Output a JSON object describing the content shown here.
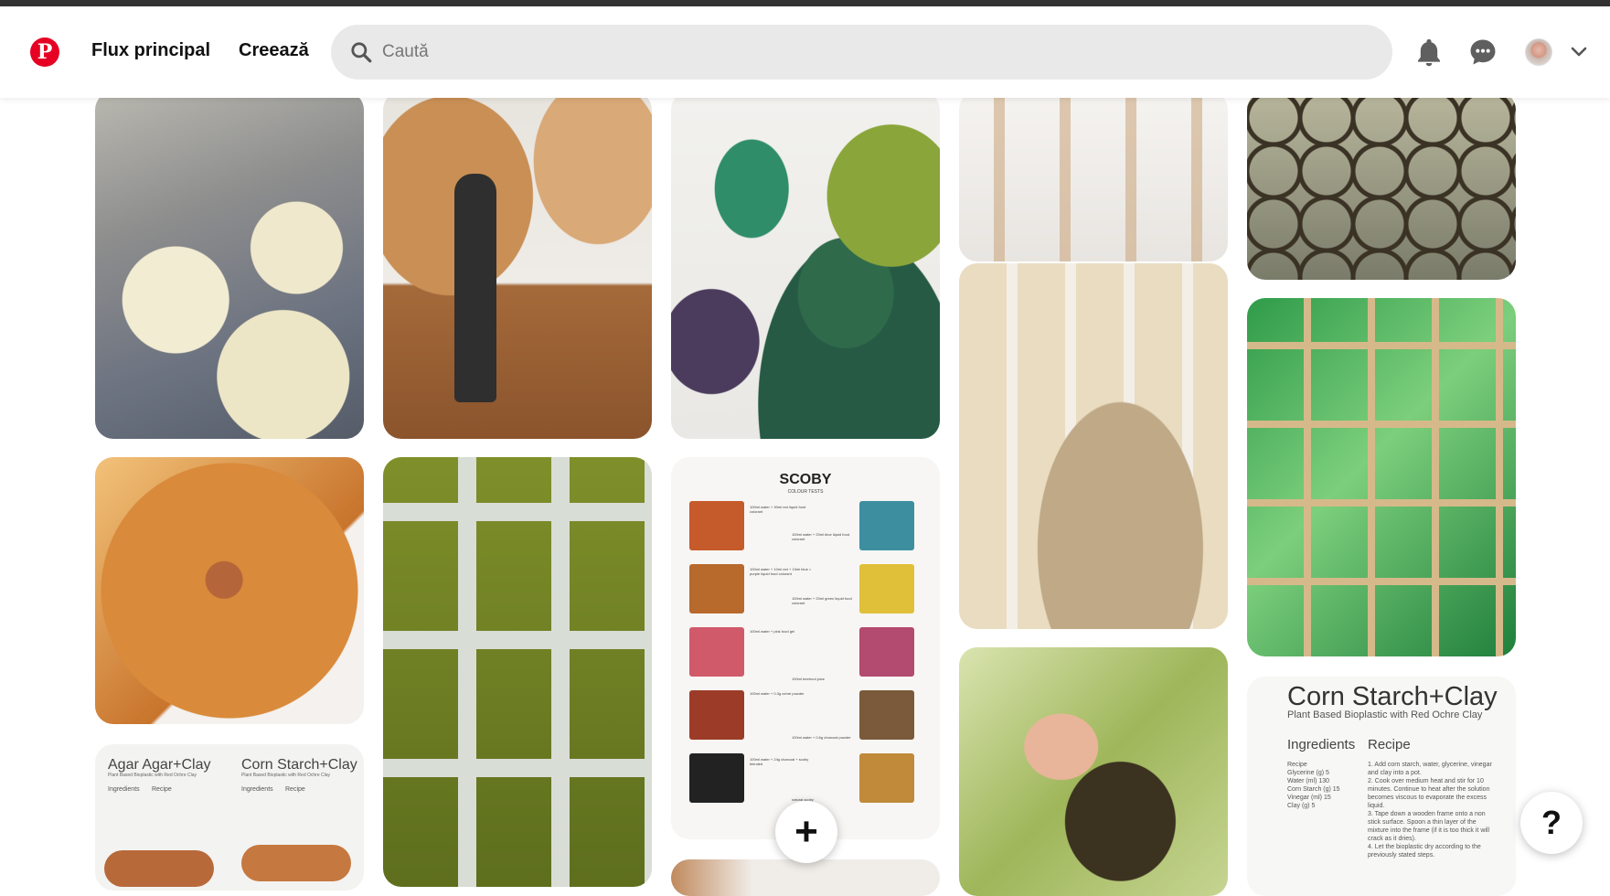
{
  "header": {
    "logo": "P",
    "nav_home": "Flux principal",
    "nav_create": "Creează",
    "search_placeholder": "Caută"
  },
  "icons": {
    "search": "search-icon",
    "notifications": "bell-icon",
    "messages": "chat-icon",
    "account_menu": "chevron-down-icon",
    "create_pin": "plus-icon",
    "help": "help-icon"
  },
  "colors": {
    "brand": "#e60023",
    "search_bg": "#e9e9e9",
    "text": "#111111"
  },
  "fab": {
    "label": "+"
  },
  "help": {
    "label": "?"
  },
  "pins": {
    "scoby": {
      "title": "SCOBY",
      "subtitle": "COLOUR TESTS",
      "captions": [
        "100ml water + 30ml red liquid food colorant",
        "100ml water + 20ml blue liquid food colorant",
        "100ml water + 10ml red + 10ml blue = purple liquid food colorant",
        "100ml water + 20ml green liquid food colorant",
        "100ml water + pink food gel",
        "100ml beetroot juice",
        "100ml water + 0.3g ochre powder",
        "100ml water + 0.6g charcoal powder",
        "100ml water + 24g charcoal + scoby blended",
        "natural scoby"
      ]
    },
    "cornstarch_large": {
      "title": "Corn Starch+Clay",
      "subtitle": "Plant Based Bioplastic with Red Ochre Clay",
      "ingredients_label": "Ingredients",
      "recipe_label": "Recipe",
      "ingredients": [
        "Recipe",
        "Glycerine (g)   5",
        "Water (ml)   130",
        "Corn Starch (g)   15",
        "Vinegar (ml)   15",
        "Clay (g)   5"
      ],
      "steps": [
        "1. Add corn starch, water, glycerine, vinegar and clay into a pot.",
        "2. Cook over medium heat and stir for 10 minutes. Continue to heat after the solution becomes viscous to evaporate the excess liquid.",
        "3. Tape down a wooden frame onto a non stick surface. Spoon a thin layer of the mixture into the frame (if it is too thick it will crack as it dries).",
        "4. Let the bioplastic dry according to the previously stated steps."
      ]
    },
    "agar_doc": {
      "title_left": "Agar Agar+Clay",
      "title_right": "Corn Starch+Clay",
      "subtitle_left": "Plant Based Bioplastic with Red Ochre Clay",
      "subtitle_right": "Plant Based Bioplastic with Red Ochre Clay",
      "ingredients_label": "Ingredients",
      "recipe_label": "Recipe"
    }
  }
}
